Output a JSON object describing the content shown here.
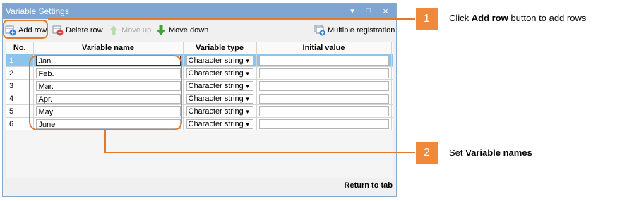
{
  "window": {
    "title": "Variable Settings",
    "minimize_label": "▾",
    "maximize_label": "□",
    "close_label": "×"
  },
  "toolbar": {
    "add_row": "Add row",
    "delete_row": "Delete row",
    "move_up": "Move up",
    "move_down": "Move down",
    "multiple_registration": "Multiple registration"
  },
  "table": {
    "columns": [
      "No.",
      "Variable name",
      "Variable type",
      "Initial value"
    ],
    "rows": [
      {
        "no": "1",
        "name": "Jan.",
        "type": "Character string",
        "initial": ""
      },
      {
        "no": "2",
        "name": "Feb.",
        "type": "Character string",
        "initial": ""
      },
      {
        "no": "3",
        "name": "Mar.",
        "type": "Character string",
        "initial": ""
      },
      {
        "no": "4",
        "name": "Apr.",
        "type": "Character string",
        "initial": ""
      },
      {
        "no": "5",
        "name": "May",
        "type": "Character string",
        "initial": ""
      },
      {
        "no": "6",
        "name": "June",
        "type": "Character string",
        "initial": ""
      }
    ]
  },
  "footer": {
    "return_label": "Return to tab"
  },
  "annotations": [
    {
      "number": "1",
      "text_before": "Click ",
      "bold": "Add row",
      "text_after": " button to add rows"
    },
    {
      "number": "2",
      "text_before": "Set ",
      "bold": "Variable names",
      "text_after": ""
    }
  ],
  "colors": {
    "accent": "#e07b2e",
    "badge": "#f08a3a",
    "titlebar": "#7fa6d3",
    "selected_row": "#8ec3ec"
  }
}
